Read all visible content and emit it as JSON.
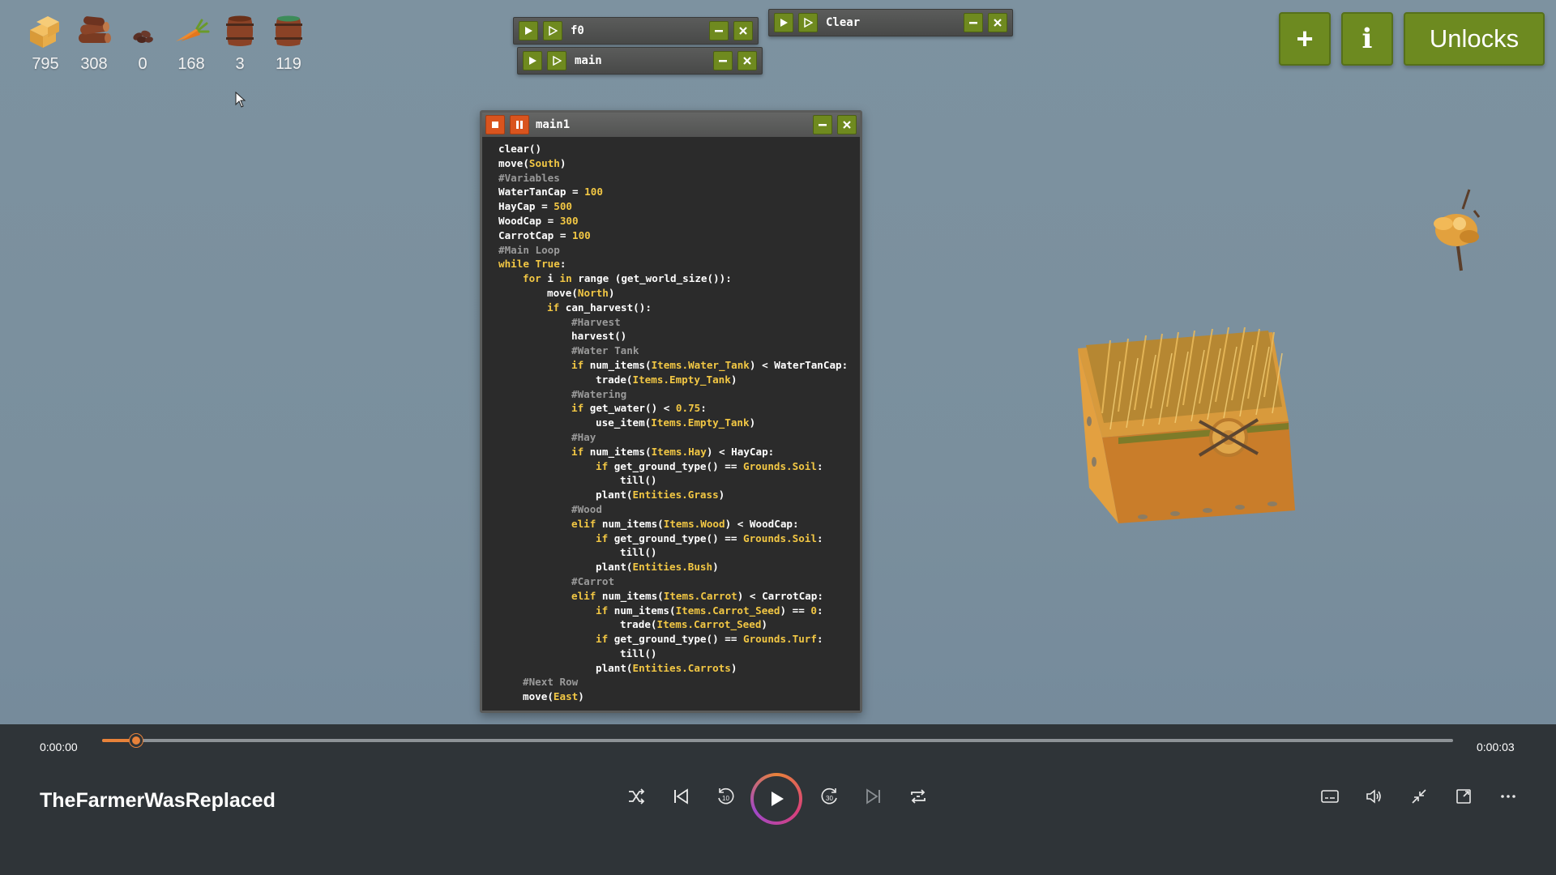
{
  "resources": [
    {
      "name": "hay",
      "count": "795"
    },
    {
      "name": "wood",
      "count": "308"
    },
    {
      "name": "carrot-seed",
      "count": "0"
    },
    {
      "name": "carrot",
      "count": "168"
    },
    {
      "name": "empty-tank",
      "count": "3"
    },
    {
      "name": "water-tank",
      "count": "119"
    }
  ],
  "windows": {
    "f0": {
      "title": "f0"
    },
    "main": {
      "title": "main"
    },
    "clear": {
      "title": "Clear"
    },
    "main1": {
      "title": "main1"
    }
  },
  "top_right": {
    "add_label": "+",
    "info_label": "i",
    "unlocks_label": "Unlocks"
  },
  "code_lines": [
    {
      "indent": 0,
      "tokens": [
        [
          "plain",
          "clear()"
        ]
      ]
    },
    {
      "indent": 0,
      "tokens": [
        [
          "plain",
          "move("
        ],
        [
          "enum",
          "South"
        ],
        [
          "plain",
          ")"
        ]
      ]
    },
    {
      "indent": 0,
      "tokens": [
        [
          "comment",
          "#Variables"
        ]
      ]
    },
    {
      "indent": 0,
      "tokens": [
        [
          "plain",
          "WaterTanCap = "
        ],
        [
          "num",
          "100"
        ]
      ]
    },
    {
      "indent": 0,
      "tokens": [
        [
          "plain",
          "HayCap = "
        ],
        [
          "num",
          "500"
        ]
      ]
    },
    {
      "indent": 0,
      "tokens": [
        [
          "plain",
          "WoodCap = "
        ],
        [
          "num",
          "300"
        ]
      ]
    },
    {
      "indent": 0,
      "tokens": [
        [
          "plain",
          "CarrotCap = "
        ],
        [
          "num",
          "100"
        ]
      ]
    },
    {
      "indent": 0,
      "tokens": [
        [
          "comment",
          "#Main Loop"
        ]
      ]
    },
    {
      "indent": 0,
      "tokens": [
        [
          "kw",
          "while"
        ],
        [
          "plain",
          " "
        ],
        [
          "kw",
          "True"
        ],
        [
          "plain",
          ":"
        ]
      ]
    },
    {
      "indent": 1,
      "tokens": [
        [
          "kw",
          "for"
        ],
        [
          "plain",
          " i "
        ],
        [
          "kw",
          "in"
        ],
        [
          "plain",
          " range (get_world_size()):"
        ]
      ]
    },
    {
      "indent": 2,
      "tokens": [
        [
          "plain",
          "move("
        ],
        [
          "enum",
          "North"
        ],
        [
          "plain",
          ")"
        ]
      ]
    },
    {
      "indent": 2,
      "tokens": [
        [
          "kw",
          "if"
        ],
        [
          "plain",
          " can_harvest():"
        ]
      ]
    },
    {
      "indent": 3,
      "tokens": [
        [
          "comment",
          "#Harvest"
        ]
      ]
    },
    {
      "indent": 3,
      "tokens": [
        [
          "plain",
          "harvest()"
        ]
      ]
    },
    {
      "indent": 3,
      "tokens": [
        [
          "comment",
          "#Water Tank"
        ]
      ]
    },
    {
      "indent": 3,
      "tokens": [
        [
          "kw",
          "if"
        ],
        [
          "plain",
          " num_items("
        ],
        [
          "enum",
          "Items.Water_Tank"
        ],
        [
          "plain",
          ") < WaterTanCap:"
        ]
      ]
    },
    {
      "indent": 4,
      "tokens": [
        [
          "plain",
          "trade("
        ],
        [
          "enum",
          "Items.Empty_Tank"
        ],
        [
          "plain",
          ")"
        ]
      ]
    },
    {
      "indent": 3,
      "tokens": [
        [
          "comment",
          "#Watering"
        ]
      ]
    },
    {
      "indent": 3,
      "tokens": [
        [
          "kw",
          "if"
        ],
        [
          "plain",
          " get_water() < "
        ],
        [
          "num",
          "0.75"
        ],
        [
          "plain",
          ":"
        ]
      ]
    },
    {
      "indent": 4,
      "tokens": [
        [
          "plain",
          "use_item("
        ],
        [
          "enum",
          "Items.Empty_Tank"
        ],
        [
          "plain",
          ")"
        ]
      ]
    },
    {
      "indent": 3,
      "tokens": [
        [
          "comment",
          "#Hay"
        ]
      ]
    },
    {
      "indent": 3,
      "tokens": [
        [
          "kw",
          "if"
        ],
        [
          "plain",
          " num_items("
        ],
        [
          "enum",
          "Items.Hay"
        ],
        [
          "plain",
          ") < HayCap:"
        ]
      ]
    },
    {
      "indent": 4,
      "tokens": [
        [
          "kw",
          "if"
        ],
        [
          "plain",
          " get_ground_type() == "
        ],
        [
          "enum",
          "Grounds.Soil"
        ],
        [
          "plain",
          ":"
        ]
      ]
    },
    {
      "indent": 5,
      "tokens": [
        [
          "plain",
          "till()"
        ]
      ]
    },
    {
      "indent": 4,
      "tokens": [
        [
          "plain",
          "plant("
        ],
        [
          "enum",
          "Entities.Grass"
        ],
        [
          "plain",
          ")"
        ]
      ]
    },
    {
      "indent": 3,
      "tokens": [
        [
          "comment",
          "#Wood"
        ]
      ]
    },
    {
      "indent": 3,
      "tokens": [
        [
          "kw",
          "elif"
        ],
        [
          "plain",
          " num_items("
        ],
        [
          "enum",
          "Items.Wood"
        ],
        [
          "plain",
          ") < WoodCap:"
        ]
      ]
    },
    {
      "indent": 4,
      "tokens": [
        [
          "kw",
          "if"
        ],
        [
          "plain",
          " get_ground_type() == "
        ],
        [
          "enum",
          "Grounds.Soil"
        ],
        [
          "plain",
          ":"
        ]
      ]
    },
    {
      "indent": 5,
      "tokens": [
        [
          "plain",
          "till()"
        ]
      ]
    },
    {
      "indent": 4,
      "tokens": [
        [
          "plain",
          "plant("
        ],
        [
          "enum",
          "Entities.Bush"
        ],
        [
          "plain",
          ")"
        ]
      ]
    },
    {
      "indent": 3,
      "tokens": [
        [
          "comment",
          "#Carrot"
        ]
      ]
    },
    {
      "indent": 3,
      "tokens": [
        [
          "kw",
          "elif"
        ],
        [
          "plain",
          " num_items("
        ],
        [
          "enum",
          "Items.Carrot"
        ],
        [
          "plain",
          ") < CarrotCap:"
        ]
      ]
    },
    {
      "indent": 4,
      "tokens": [
        [
          "kw",
          "if"
        ],
        [
          "plain",
          " num_items("
        ],
        [
          "enum",
          "Items.Carrot_Seed"
        ],
        [
          "plain",
          ") == "
        ],
        [
          "num",
          "0"
        ],
        [
          "plain",
          ":"
        ]
      ]
    },
    {
      "indent": 5,
      "tokens": [
        [
          "plain",
          "trade("
        ],
        [
          "enum",
          "Items.Carrot_Seed"
        ],
        [
          "plain",
          ")"
        ]
      ]
    },
    {
      "indent": 4,
      "tokens": [
        [
          "kw",
          "if"
        ],
        [
          "plain",
          " get_ground_type() == "
        ],
        [
          "enum",
          "Grounds.Turf"
        ],
        [
          "plain",
          ":"
        ]
      ]
    },
    {
      "indent": 5,
      "tokens": [
        [
          "plain",
          "till()"
        ]
      ]
    },
    {
      "indent": 4,
      "tokens": [
        [
          "plain",
          "plant("
        ],
        [
          "enum",
          "Entities.Carrots"
        ],
        [
          "plain",
          ")"
        ]
      ]
    },
    {
      "indent": 1,
      "tokens": [
        [
          "comment",
          "#Next Row"
        ]
      ]
    },
    {
      "indent": 1,
      "tokens": [
        [
          "plain",
          "move("
        ],
        [
          "enum",
          "East"
        ],
        [
          "plain",
          ")"
        ]
      ]
    }
  ],
  "player": {
    "current_time": "0:00:00",
    "total_time": "0:00:03",
    "progress": 0.025,
    "title": "TheFarmerWasReplaced"
  },
  "colors": {
    "accent": "#e8823a",
    "olive": "#6d8a20",
    "keyword": "#f2c744"
  }
}
